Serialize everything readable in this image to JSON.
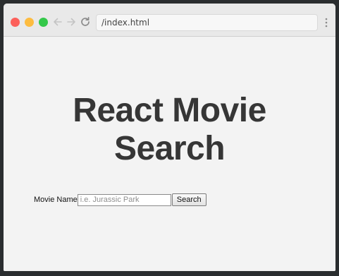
{
  "browser": {
    "url": "/index.html",
    "colors": {
      "close": "#fc605b",
      "minimize": "#fdbc40",
      "maximize": "#34c84a"
    }
  },
  "page": {
    "title_line1": "React Movie",
    "title_line2": "Search",
    "form": {
      "label": "Movie Name",
      "input_placeholder": "i.e. Jurassic Park",
      "input_value": "",
      "button_label": "Search"
    }
  }
}
